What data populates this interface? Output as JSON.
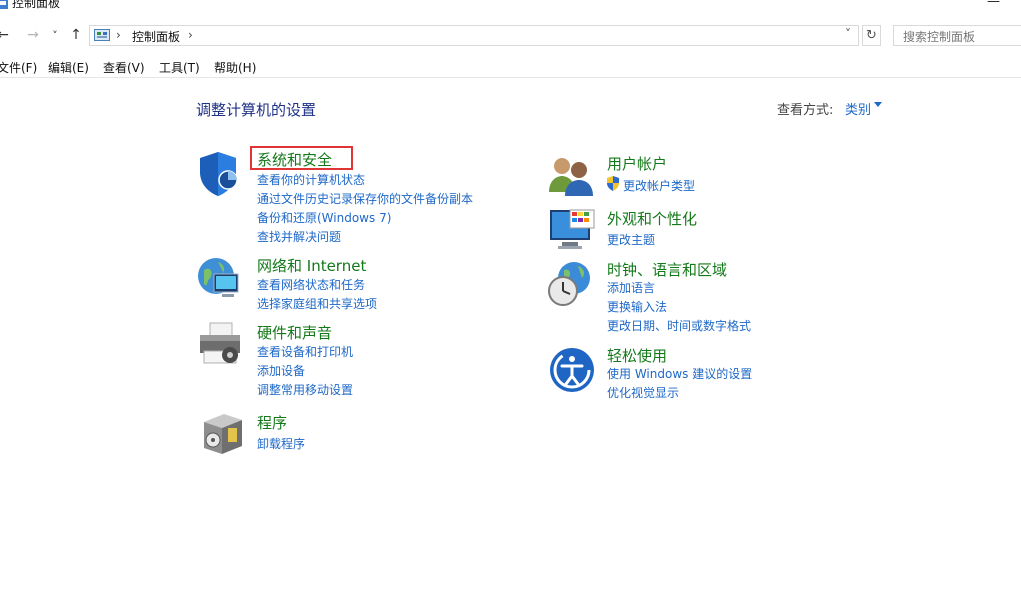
{
  "window": {
    "title": "控制面板",
    "close_glyph": "—"
  },
  "nav": {
    "back_glyph": "←",
    "forward_glyph": "→",
    "recent_glyph": "˅",
    "up_glyph": "↑"
  },
  "address": {
    "separator": "›",
    "path_item": "控制面板",
    "dropdown_glyph": "˅",
    "refresh_glyph": "↻"
  },
  "search": {
    "placeholder": "搜索控制面板"
  },
  "menu": [
    "文件(F)",
    "编辑(E)",
    "查看(V)",
    "工具(T)",
    "帮助(H)"
  ],
  "content": {
    "heading": "调整计算机的设置",
    "view_by_label": "查看方式:",
    "view_by_value": "类别"
  },
  "categories": [
    {
      "title": "系统和安全",
      "icon": "shield-icon",
      "links": [
        "查看你的计算机状态",
        "通过文件历史记录保存你的文件备份副本",
        "备份和还原(Windows 7)",
        "查找并解决问题"
      ]
    },
    {
      "title": "网络和 Internet",
      "icon": "network-globe-icon",
      "links": [
        "查看网络状态和任务",
        "选择家庭组和共享选项"
      ]
    },
    {
      "title": "硬件和声音",
      "icon": "printer-icon",
      "links": [
        "查看设备和打印机",
        "添加设备",
        "调整常用移动设置"
      ]
    },
    {
      "title": "程序",
      "icon": "programs-box-icon",
      "links": [
        "卸载程序"
      ]
    },
    {
      "title": "用户帐户",
      "icon": "users-icon",
      "links": [
        "更改帐户类型"
      ]
    },
    {
      "title": "外观和个性化",
      "icon": "monitor-palette-icon",
      "links": [
        "更改主题"
      ]
    },
    {
      "title": "时钟、语言和区域",
      "icon": "clock-globe-icon",
      "links": [
        "添加语言",
        "更换输入法",
        "更改日期、时间或数字格式"
      ]
    },
    {
      "title": "轻松使用",
      "icon": "ease-of-access-icon",
      "links": [
        "使用 Windows 建议的设置",
        "优化视觉显示"
      ]
    }
  ],
  "colors": {
    "category_title": "#14791a",
    "link": "#1e68c8",
    "heading": "#1e3287",
    "highlight_box": "#e03535"
  }
}
